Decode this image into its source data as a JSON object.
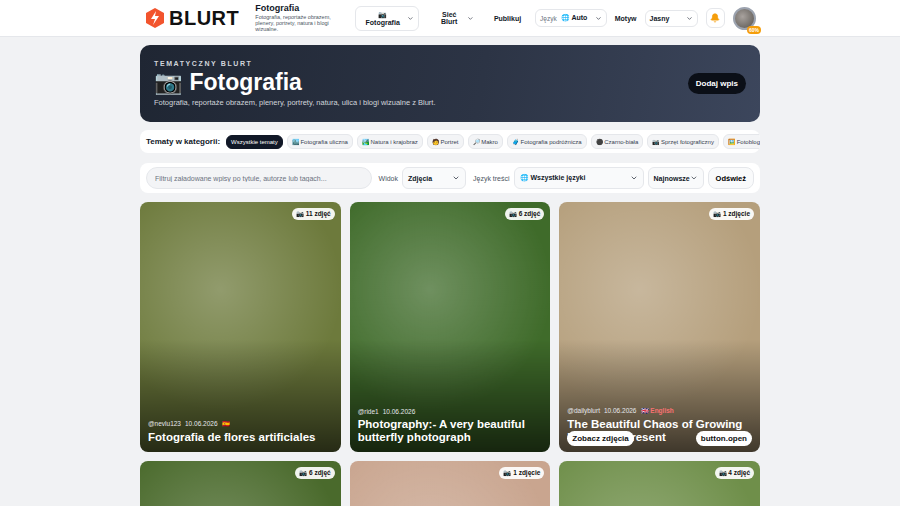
{
  "header": {
    "logo": "BLURT",
    "site_title": "Fotografia",
    "site_description": "Fotografia, reportaże obrazem, plenery, portrety, natura i blogi wizualne.",
    "nav": [
      {
        "label": "📷 Fotografia",
        "dropdown": true,
        "selected": true
      },
      {
        "label": "Sieć Blurt",
        "dropdown": true,
        "selected": false
      },
      {
        "label": "Publikuj",
        "dropdown": false,
        "selected": false
      }
    ],
    "language": {
      "label": "Język",
      "value": "🌐 Auto"
    },
    "theme": {
      "label": "Motyw",
      "value": "Jasny"
    },
    "avatar_badge": "60%"
  },
  "hero": {
    "eyebrow": "TEMATYCZNY BLURT",
    "title": "📷 Fotografia",
    "subtitle": "Fotografia, reportaże obrazem, plenery, portrety, natura, ulica i blogi wizualne z Blurt.",
    "button": "Dodaj wpis"
  },
  "topics": {
    "label": "Tematy w kategorii:",
    "items": [
      {
        "label": "Wszystkie tematy",
        "selected": true
      },
      {
        "label": "🏙️ Fotografia uliczna",
        "selected": false
      },
      {
        "label": "🏞️ Natura i krajobraz",
        "selected": false
      },
      {
        "label": "🧑 Portret",
        "selected": false
      },
      {
        "label": "🔎 Makro",
        "selected": false
      },
      {
        "label": "🧳 Fotografia podróżnicza",
        "selected": false
      },
      {
        "label": "⚫ Czarno-biała",
        "selected": false
      },
      {
        "label": "📷 Sprzęt fotograficzny",
        "selected": false
      },
      {
        "label": "🖼️ Fotoblog",
        "selected": false
      }
    ]
  },
  "filters": {
    "search_placeholder": "Filtruj załadowane wpisy po tytule, autorze lub tagach...",
    "view_label": "Widok",
    "view_value": "Zdjęcia",
    "language_label": "Język treści",
    "language_value": "🌐 Wszystkie języki",
    "sort_value": "Najnowsze",
    "refresh": "Odśwież"
  },
  "posts": [
    {
      "photo_count": "📷 11 zdjęć",
      "author": "@nevlu123",
      "date": "10.06.2026",
      "language": "🇪🇸",
      "title": "Fotografia de flores artificiales",
      "color": "#6d7a3c",
      "hovered": false
    },
    {
      "photo_count": "📷 6 zdjęć",
      "author": "@ride1",
      "date": "10.06.2026",
      "title": "Photography:- A very beautiful butterfly photograph",
      "color": "#3f6b2a",
      "hovered": false
    },
    {
      "photo_count": "📷 1 zdjęcie",
      "author": "@dailyblurt",
      "date": "10.06.2026",
      "language": "🇬🇧 English",
      "title": "The Beautiful Chaos of Growing Up: in the Present",
      "color": "#b59f7c",
      "hovered": true,
      "actions": [
        "Zobacz zdjęcia",
        "button.open"
      ]
    },
    {
      "photo_count": "📷 6 zdjęć",
      "color": "#4a6a2c",
      "hovered": false
    },
    {
      "photo_count": "📷 1 zdjęcie",
      "color": "#c9a58f",
      "hovered": false
    },
    {
      "photo_count": "📷 4 zdjęć",
      "color": "#6f8f4a",
      "hovered": false
    }
  ]
}
